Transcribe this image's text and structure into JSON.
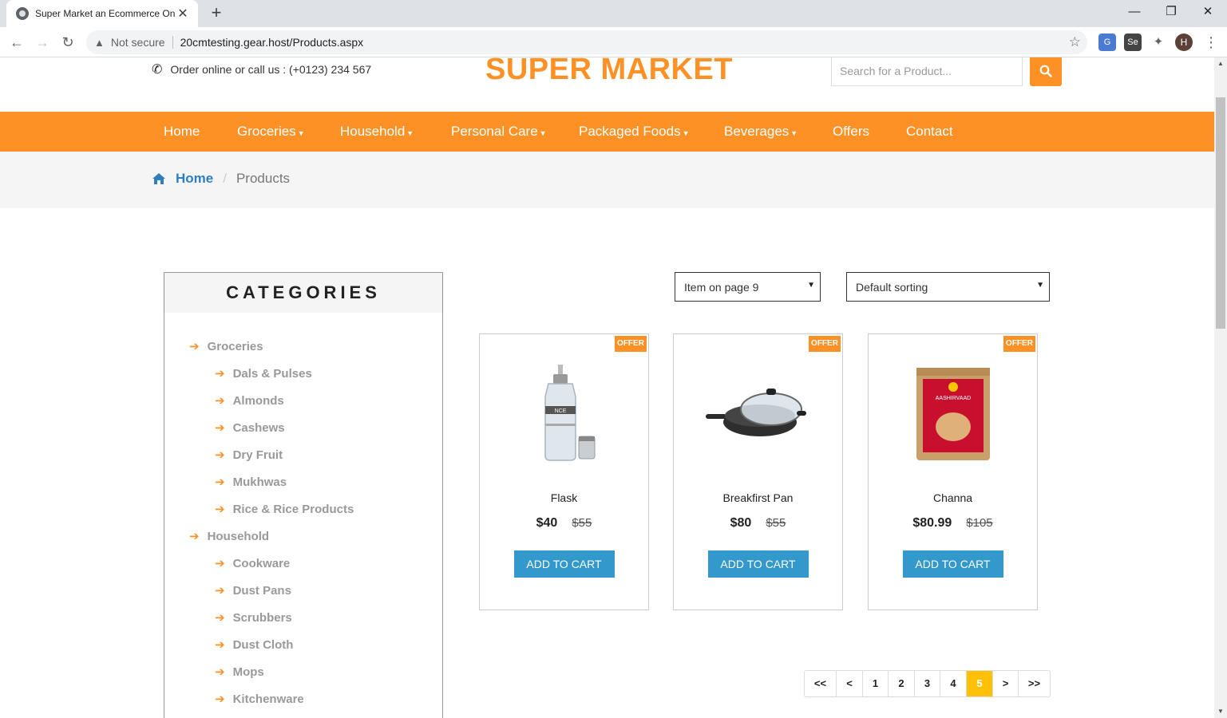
{
  "browser": {
    "tab_title": "Super Market an Ecommerce Onl",
    "security_label": "Not secure",
    "url": "20cmtesting.gear.host/Products.aspx",
    "profile_initial": "H"
  },
  "header": {
    "phone_text": "Order online or call us : (+0123) 234 567",
    "brand": "SUPER MARKET",
    "search_placeholder": "Search for a Product..."
  },
  "nav": {
    "items": [
      {
        "label": "Home",
        "dropdown": false
      },
      {
        "label": "Groceries",
        "dropdown": true
      },
      {
        "label": "Household",
        "dropdown": true
      },
      {
        "label": "Personal Care",
        "dropdown": true
      },
      {
        "label": "Packaged Foods",
        "dropdown": true
      },
      {
        "label": "Beverages",
        "dropdown": true
      },
      {
        "label": "Offers",
        "dropdown": false
      },
      {
        "label": "Contact",
        "dropdown": false
      }
    ]
  },
  "breadcrumb": {
    "home": "Home",
    "current": "Products"
  },
  "categories": {
    "title": "CATEGORIES",
    "items": [
      {
        "label": "Groceries",
        "level": 0
      },
      {
        "label": "Dals & Pulses",
        "level": 1
      },
      {
        "label": "Almonds",
        "level": 1
      },
      {
        "label": "Cashews",
        "level": 1
      },
      {
        "label": "Dry Fruit",
        "level": 1
      },
      {
        "label": "Mukhwas",
        "level": 1
      },
      {
        "label": "Rice & Rice Products",
        "level": 1
      },
      {
        "label": "Household",
        "level": 0
      },
      {
        "label": "Cookware",
        "level": 1
      },
      {
        "label": "Dust Pans",
        "level": 1
      },
      {
        "label": "Scrubbers",
        "level": 1
      },
      {
        "label": "Dust Cloth",
        "level": 1
      },
      {
        "label": "Mops",
        "level": 1
      },
      {
        "label": "Kitchenware",
        "level": 1
      }
    ]
  },
  "controls": {
    "items_per_page": "Item on page 9",
    "sorting": "Default sorting"
  },
  "products": [
    {
      "name": "Flask",
      "price": "$40",
      "old_price": "$55",
      "badge": "OFFER",
      "button": "ADD TO CART",
      "image": "flask"
    },
    {
      "name": "Breakfirst Pan",
      "price": "$80",
      "old_price": "$55",
      "badge": "OFFER",
      "button": "ADD TO CART",
      "image": "pan"
    },
    {
      "name": "Channa",
      "price": "$80.99",
      "old_price": "$105",
      "badge": "OFFER",
      "button": "ADD TO CART",
      "image": "flour-bag"
    }
  ],
  "pagination": {
    "pages": [
      "<<",
      "<",
      "1",
      "2",
      "3",
      "4",
      "5",
      ">",
      ">>"
    ],
    "active": "5"
  },
  "colors": {
    "accent": "#fe9126",
    "link": "#2f7fbf",
    "button": "#3399cc",
    "active_page": "#ffc107"
  }
}
